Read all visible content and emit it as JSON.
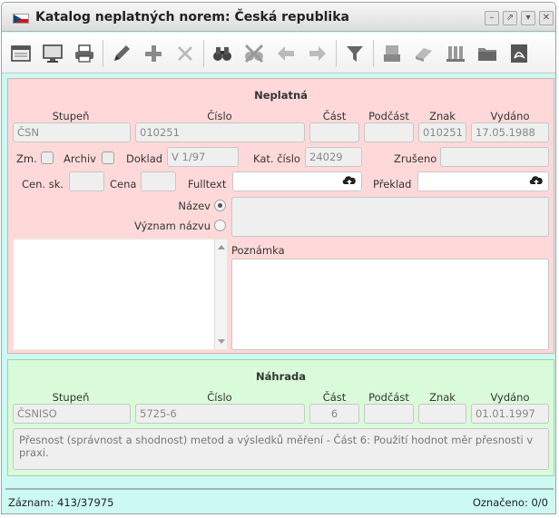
{
  "window": {
    "title": "Katalog neplatných norem: Česká republika"
  },
  "colors": {
    "invalid_panel": "#ffd9d9",
    "replacement_panel": "#d9fbd9",
    "window_bg": "#ccfaf3"
  },
  "toolbar": {
    "icons": [
      "table-view-icon",
      "monitor-icon",
      "printer-icon",
      "edit-icon",
      "add-icon",
      "delete-icon",
      "binoculars-icon",
      "filter-clear-icon",
      "arrow-left-icon",
      "arrow-right-icon",
      "funnel-icon",
      "stamp-icon",
      "eraser-icon",
      "document-stack-icon",
      "folder-icon",
      "pdf-icon"
    ]
  },
  "invalid": {
    "section_title": "Neplatná",
    "labels": {
      "stupen": "Stupeň",
      "cislo": "Číslo",
      "cast": "Část",
      "podcast": "Podčást",
      "znak": "Znak",
      "vydano": "Vydáno",
      "zm": "Zm.",
      "archiv": "Archiv",
      "doklad": "Doklad",
      "kat_cislo": "Kat. číslo",
      "zruseno": "Zrušeno",
      "cen_sk": "Cen. sk.",
      "cena": "Cena",
      "fulltext": "Fulltext",
      "preklad": "Překlad",
      "nazev": "Název",
      "vyznam_nazvu": "Význam názvu",
      "poznamka": "Poznámka"
    },
    "values": {
      "stupen": "ČSN",
      "cislo": "010251",
      "cast": "",
      "podcast": "",
      "znak": "010251",
      "vydano": "17.05.1988",
      "doklad": "V 1/97",
      "kat_cislo": "24029",
      "zruseno": "",
      "cen_sk": "",
      "cena": "",
      "fulltext": "",
      "preklad": ""
    }
  },
  "replacement": {
    "section_title": "Náhrada",
    "labels": {
      "stupen": "Stupeň",
      "cislo": "Číslo",
      "cast": "Část",
      "podcast": "Podčást",
      "znak": "Znak",
      "vydano": "Vydáno"
    },
    "values": {
      "stupen": "ČSNISO",
      "cislo": "5725-6",
      "cast": "6",
      "podcast": "",
      "znak": "",
      "vydano": "01.01.1997",
      "description": "Přesnost (správnost a shodnost) metod a výsledků měření - Část 6: Použití hodnot měr přesnosti v praxi."
    }
  },
  "status": {
    "record": "Záznam: 413/37975",
    "marked": "Označeno: 0/0"
  }
}
